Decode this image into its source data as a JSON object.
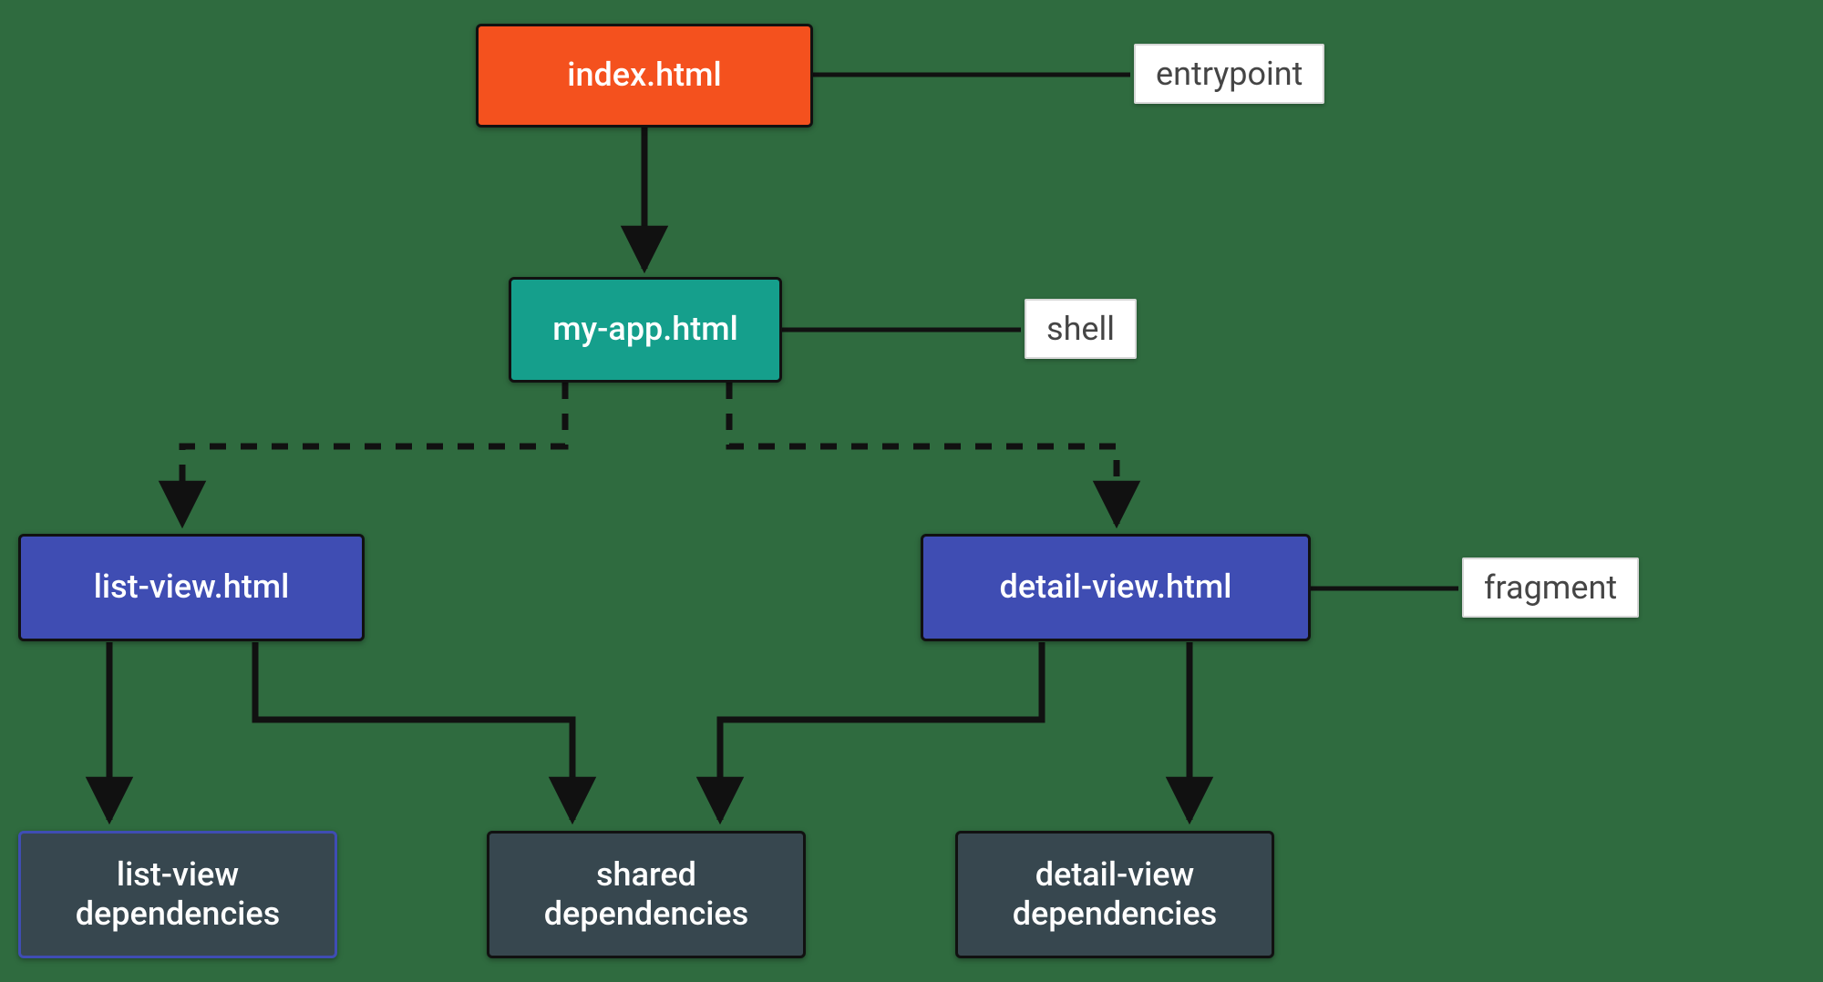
{
  "nodes": {
    "index": {
      "text": "index.html"
    },
    "myapp": {
      "text": "my-app.html"
    },
    "listview": {
      "text": "list-view.html"
    },
    "detailview": {
      "text": "detail-view.html"
    },
    "listdeps": {
      "text": "list-view\ndependencies"
    },
    "shareddeps": {
      "text": "shared\ndependencies"
    },
    "detaildeps": {
      "text": "detail-view\ndependencies"
    }
  },
  "labels": {
    "entrypoint": "entrypoint",
    "shell": "shell",
    "fragment": "fragment"
  },
  "edges": [
    {
      "from": "index",
      "to": "myapp",
      "style": "solid"
    },
    {
      "from": "myapp",
      "to": "listview",
      "style": "dashed"
    },
    {
      "from": "myapp",
      "to": "detailview",
      "style": "dashed"
    },
    {
      "from": "listview",
      "to": "listdeps",
      "style": "solid"
    },
    {
      "from": "listview",
      "to": "shareddeps",
      "style": "solid"
    },
    {
      "from": "detailview",
      "to": "shareddeps",
      "style": "solid"
    },
    {
      "from": "detailview",
      "to": "detaildeps",
      "style": "solid"
    }
  ]
}
